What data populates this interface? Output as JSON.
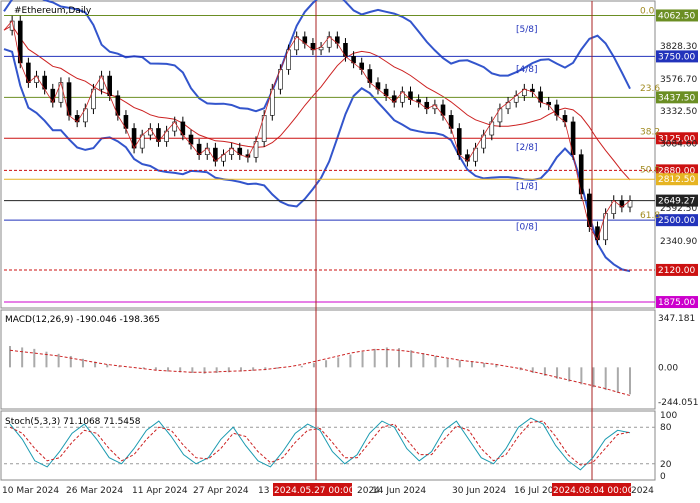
{
  "chart_data": {
    "type": "line",
    "title": "#Ethereum,Daily",
    "x_labels": [
      "10 Mar 2024",
      "26 Mar 2024",
      "11 Apr 2024",
      "27 Apr 2024",
      "13 M",
      "2024.05.27 00:00",
      "2024",
      "14 Jun 2024",
      "30 Jun 2024",
      "16 Jul 20",
      "2024.08.04 00:00",
      "2024"
    ],
    "highlighted_dates": [
      "2024.05.27 00:00",
      "2024.08.04 00:00"
    ],
    "price_axis": {
      "ticks": [
        "3828.30",
        "3576.70",
        "3332.50",
        "3084.60",
        "2592.50",
        "2340.90"
      ],
      "ylim": [
        1875,
        4062.5
      ]
    },
    "price_levels": [
      {
        "label": "4062.50",
        "value": 4062.5,
        "color": "#6b8e23"
      },
      {
        "label": "3750.00",
        "value": 3750.0,
        "color": "#2233bb"
      },
      {
        "label": "3437.50",
        "value": 3437.5,
        "color": "#6b8e23"
      },
      {
        "label": "3125.00",
        "value": 3125.0,
        "color": "#cc1111"
      },
      {
        "label": "2880.00",
        "value": 2880.0,
        "color": "#cc1111"
      },
      {
        "label": "2812.50",
        "value": 2812.5,
        "color": "#e6b422"
      },
      {
        "label": "2649.27",
        "value": 2649.27,
        "color": "#222222"
      },
      {
        "label": "2500.00",
        "value": 2500.0,
        "color": "#2233bb"
      },
      {
        "label": "2120.00",
        "value": 2120.0,
        "color": "#cc1111"
      },
      {
        "label": "1875.00",
        "value": 1875.0,
        "color": "#cc00cc"
      }
    ],
    "murrey_labels": [
      {
        "label": "[5/8]",
        "value": 3958
      },
      {
        "label": "[4/8]",
        "value": 3655
      },
      {
        "label": "[2/8]",
        "value": 3060
      },
      {
        "label": "[1/8]",
        "value": 2760
      },
      {
        "label": "[0/8]",
        "value": 2450
      }
    ],
    "fib_labels": [
      {
        "label": "0.0",
        "value": 4062.5
      },
      {
        "label": "23.6",
        "value": 3470
      },
      {
        "label": "38.2",
        "value": 3140
      },
      {
        "label": "50.0",
        "value": 2850
      },
      {
        "label": "61.8",
        "value": 2500
      }
    ],
    "close_series": [
      3950,
      4020,
      3700,
      3550,
      3600,
      3500,
      3400,
      3550,
      3300,
      3250,
      3350,
      3500,
      3600,
      3450,
      3300,
      3200,
      3050,
      3150,
      3200,
      3100,
      3180,
      3250,
      3150,
      3080,
      3000,
      3050,
      2950,
      3000,
      3050,
      3000,
      2980,
      3100,
      3300,
      3500,
      3650,
      3800,
      3900,
      3850,
      3800,
      3820,
      3900,
      3850,
      3750,
      3700,
      3650,
      3550,
      3500,
      3450,
      3400,
      3480,
      3420,
      3400,
      3350,
      3380,
      3300,
      3200,
      3000,
      2950,
      3050,
      3150,
      3250,
      3350,
      3400,
      3450,
      3500,
      3480,
      3400,
      3380,
      3300,
      3250,
      3000,
      2700,
      2450,
      2350,
      2550,
      2650,
      2600,
      2649.27
    ],
    "macd": {
      "label": "MACD(12,26,9) -190.046 -198.365",
      "ticks": [
        "347.181",
        "0.00",
        "-244.051"
      ],
      "ylim": [
        -244.051,
        347.181
      ],
      "histogram": [
        150,
        140,
        130,
        110,
        95,
        80,
        60,
        40,
        20,
        10,
        0,
        -10,
        -20,
        -30,
        -35,
        -40,
        -45,
        -40,
        -35,
        -30,
        -25,
        -20,
        -10,
        0,
        10,
        30,
        50,
        70,
        90,
        110,
        130,
        140,
        135,
        120,
        100,
        80,
        60,
        50,
        40,
        30,
        20,
        0,
        -20,
        -40,
        -60,
        -80,
        -100,
        -120,
        -140,
        -160,
        -180,
        -190
      ],
      "signal": [
        120,
        110,
        100,
        90,
        80,
        65,
        50,
        35,
        20,
        10,
        0,
        -10,
        -20,
        -25,
        -30,
        -35,
        -35,
        -32,
        -28,
        -25,
        -20,
        -15,
        -5,
        5,
        20,
        40,
        60,
        80,
        100,
        115,
        125,
        125,
        120,
        110,
        95,
        80,
        65,
        50,
        40,
        30,
        20,
        5,
        -10,
        -30,
        -50,
        -70,
        -90,
        -110,
        -130,
        -150,
        -175,
        -198
      ]
    },
    "stoch": {
      "label": "Stoch(5,3,3) 71.1068 71.5458",
      "ticks": [
        "100",
        "80",
        "20",
        "0"
      ],
      "ylim": [
        0,
        100
      ],
      "k": [
        85,
        60,
        25,
        15,
        40,
        70,
        85,
        60,
        30,
        20,
        45,
        75,
        90,
        65,
        35,
        20,
        30,
        60,
        80,
        50,
        25,
        15,
        40,
        70,
        85,
        75,
        40,
        20,
        35,
        70,
        90,
        80,
        45,
        25,
        40,
        75,
        90,
        60,
        30,
        20,
        45,
        80,
        95,
        85,
        50,
        25,
        10,
        30,
        60,
        75,
        71
      ],
      "d": [
        80,
        70,
        45,
        25,
        30,
        55,
        75,
        70,
        45,
        25,
        35,
        60,
        80,
        75,
        50,
        30,
        28,
        45,
        70,
        65,
        40,
        22,
        30,
        55,
        75,
        78,
        55,
        30,
        30,
        55,
        80,
        85,
        60,
        35,
        35,
        60,
        82,
        75,
        45,
        25,
        35,
        65,
        88,
        90,
        65,
        35,
        18,
        22,
        45,
        68,
        72
      ]
    }
  }
}
